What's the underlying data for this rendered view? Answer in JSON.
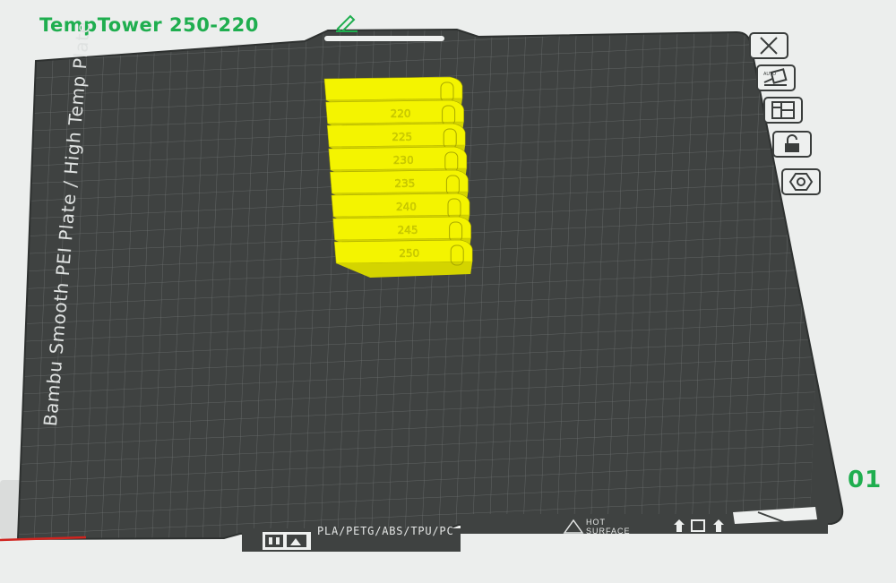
{
  "plate": {
    "title": "TempTower 250-220",
    "number": "01",
    "bed_label": "Bambu Smooth PEI Plate / High Temp Plate",
    "footer_materials": "PLA/PETG/ABS/TPU/PC",
    "hot_line1": "HOT",
    "hot_line2": "SURFACE"
  },
  "model": {
    "temperatures": [
      "220",
      "225",
      "230",
      "235",
      "240",
      "245",
      "250"
    ],
    "color": "#f4f400"
  },
  "colors": {
    "accent": "#1fae4f",
    "bed": "#3f4241",
    "grid": "#6c706f",
    "background": "#eceeed"
  },
  "toolbar": {
    "items": [
      {
        "name": "delete-plate-button",
        "icon": "close-icon"
      },
      {
        "name": "auto-orient-button",
        "icon": "auto-orient-icon"
      },
      {
        "name": "arrange-button",
        "icon": "arrange-icon"
      },
      {
        "name": "lock-plate-button",
        "icon": "lock-icon"
      },
      {
        "name": "plate-settings-button",
        "icon": "hex-nut-icon"
      }
    ]
  }
}
